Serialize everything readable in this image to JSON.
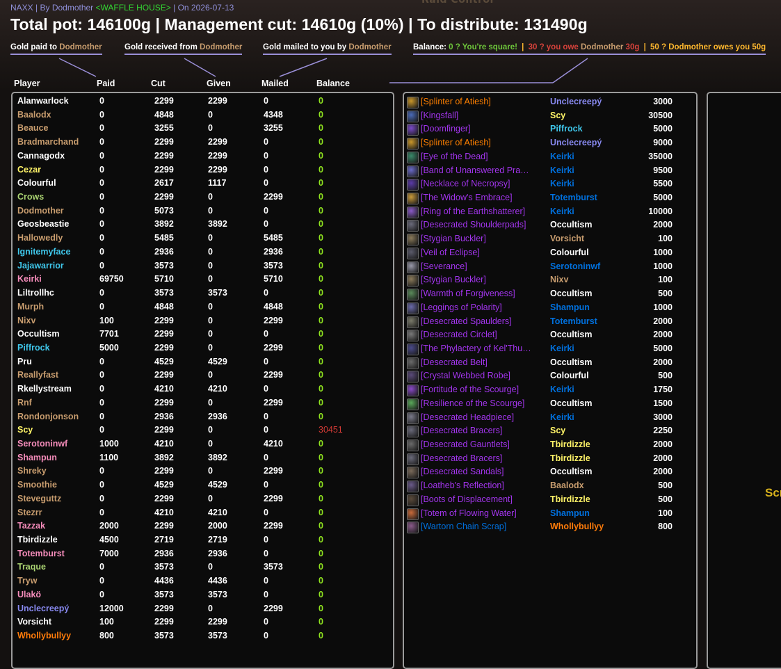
{
  "background": {
    "title": "Raid Control"
  },
  "header": {
    "raid": "NAXX",
    "by_label": "| By Dodmother",
    "guild": "<WAFFLE HOUSE>",
    "date": "| On 2026-07-13",
    "summary": "Total pot: 146100g | Management cut: 14610g (10%) | To distribute: 131490g"
  },
  "legend": {
    "paid_prefix": "Gold paid to",
    "received_prefix": "Gold received from",
    "mailed_prefix": "Gold mailed to you by",
    "name": "Dodmother",
    "balance_label": "Balance:",
    "square": "0 ? You're square!",
    "owe_prefix": "30 ? you owe",
    "owe_amount": "30g",
    "owes_prefix": "50 ? Dodmother owes you 50g",
    "sep": "|"
  },
  "columns": {
    "player": "Player",
    "paid": "Paid",
    "cut": "Cut",
    "given": "Given",
    "mailed": "Mailed",
    "balance": "Balance"
  },
  "class_colors": {
    "warlock": "#8788ee",
    "warrior": "#c79c6e",
    "priest": "#ffffff",
    "rogue": "#fff468",
    "hunter": "#aad372",
    "mage": "#3fc7eb",
    "paladin": "#f48cba",
    "shaman": "#0070dd",
    "druid": "#ff7c0a"
  },
  "players": [
    {
      "name": "Alanwarlock",
      "cls": "priest",
      "paid": "0",
      "cut": "2299",
      "given": "2299",
      "mailed": "0",
      "balance": "0"
    },
    {
      "name": "Baalodx",
      "cls": "warrior",
      "paid": "0",
      "cut": "4848",
      "given": "0",
      "mailed": "4348",
      "balance": "0"
    },
    {
      "name": "Beauce",
      "cls": "warrior",
      "paid": "0",
      "cut": "3255",
      "given": "0",
      "mailed": "3255",
      "balance": "0"
    },
    {
      "name": "Bradmarchand",
      "cls": "warrior",
      "paid": "0",
      "cut": "2299",
      "given": "2299",
      "mailed": "0",
      "balance": "0"
    },
    {
      "name": "Cannagodx",
      "cls": "priest",
      "paid": "0",
      "cut": "2299",
      "given": "2299",
      "mailed": "0",
      "balance": "0"
    },
    {
      "name": "Cezar",
      "cls": "rogue",
      "paid": "0",
      "cut": "2299",
      "given": "2299",
      "mailed": "0",
      "balance": "0"
    },
    {
      "name": "Colourful",
      "cls": "priest",
      "paid": "0",
      "cut": "2617",
      "given": "1117",
      "mailed": "0",
      "balance": "0"
    },
    {
      "name": "Crows",
      "cls": "hunter",
      "paid": "0",
      "cut": "2299",
      "given": "0",
      "mailed": "2299",
      "balance": "0"
    },
    {
      "name": "Dodmother",
      "cls": "warrior",
      "paid": "0",
      "cut": "5073",
      "given": "0",
      "mailed": "0",
      "balance": "0"
    },
    {
      "name": "Geosbeastie",
      "cls": "priest",
      "paid": "0",
      "cut": "3892",
      "given": "3892",
      "mailed": "0",
      "balance": "0"
    },
    {
      "name": "Hallowedly",
      "cls": "warrior",
      "paid": "0",
      "cut": "5485",
      "given": "0",
      "mailed": "5485",
      "balance": "0"
    },
    {
      "name": "Ignitemyface",
      "cls": "mage",
      "paid": "0",
      "cut": "2936",
      "given": "0",
      "mailed": "2936",
      "balance": "0"
    },
    {
      "name": "Jajawarrior",
      "cls": "mage",
      "paid": "0",
      "cut": "3573",
      "given": "0",
      "mailed": "3573",
      "balance": "0"
    },
    {
      "name": "Keirki",
      "cls": "paladin",
      "paid": "69750",
      "cut": "5710",
      "given": "0",
      "mailed": "5710",
      "balance": "0"
    },
    {
      "name": "Liltrollhc",
      "cls": "priest",
      "paid": "0",
      "cut": "3573",
      "given": "3573",
      "mailed": "0",
      "balance": "0"
    },
    {
      "name": "Murph",
      "cls": "warrior",
      "paid": "0",
      "cut": "4848",
      "given": "0",
      "mailed": "4848",
      "balance": "0"
    },
    {
      "name": "Nixv",
      "cls": "warrior",
      "paid": "100",
      "cut": "2299",
      "given": "0",
      "mailed": "2299",
      "balance": "0"
    },
    {
      "name": "Occultism",
      "cls": "priest",
      "paid": "7701",
      "cut": "2299",
      "given": "0",
      "mailed": "0",
      "balance": "0"
    },
    {
      "name": "Piffrock",
      "cls": "mage",
      "paid": "5000",
      "cut": "2299",
      "given": "0",
      "mailed": "2299",
      "balance": "0"
    },
    {
      "name": "Pru",
      "cls": "priest",
      "paid": "0",
      "cut": "4529",
      "given": "4529",
      "mailed": "0",
      "balance": "0"
    },
    {
      "name": "Reallyfast",
      "cls": "warrior",
      "paid": "0",
      "cut": "2299",
      "given": "0",
      "mailed": "2299",
      "balance": "0"
    },
    {
      "name": "Rkellystream",
      "cls": "priest",
      "paid": "0",
      "cut": "4210",
      "given": "4210",
      "mailed": "0",
      "balance": "0"
    },
    {
      "name": "Rnf",
      "cls": "warrior",
      "paid": "0",
      "cut": "2299",
      "given": "0",
      "mailed": "2299",
      "balance": "0"
    },
    {
      "name": "Rondonjonson",
      "cls": "warrior",
      "paid": "0",
      "cut": "2936",
      "given": "2936",
      "mailed": "0",
      "balance": "0"
    },
    {
      "name": "Scy",
      "cls": "rogue",
      "paid": "0",
      "cut": "2299",
      "given": "0",
      "mailed": "0",
      "balance": "30451",
      "neg": true
    },
    {
      "name": "Serotoninwf",
      "cls": "paladin",
      "paid": "1000",
      "cut": "4210",
      "given": "0",
      "mailed": "4210",
      "balance": "0"
    },
    {
      "name": "Shampun",
      "cls": "paladin",
      "paid": "1100",
      "cut": "3892",
      "given": "3892",
      "mailed": "0",
      "balance": "0"
    },
    {
      "name": "Shreky",
      "cls": "warrior",
      "paid": "0",
      "cut": "2299",
      "given": "0",
      "mailed": "2299",
      "balance": "0"
    },
    {
      "name": "Smoothie",
      "cls": "warrior",
      "paid": "0",
      "cut": "4529",
      "given": "4529",
      "mailed": "0",
      "balance": "0"
    },
    {
      "name": "Steveguttz",
      "cls": "warrior",
      "paid": "0",
      "cut": "2299",
      "given": "0",
      "mailed": "2299",
      "balance": "0"
    },
    {
      "name": "Stezrr",
      "cls": "warrior",
      "paid": "0",
      "cut": "4210",
      "given": "4210",
      "mailed": "0",
      "balance": "0"
    },
    {
      "name": "Tazzak",
      "cls": "paladin",
      "paid": "2000",
      "cut": "2299",
      "given": "2000",
      "mailed": "2299",
      "balance": "0"
    },
    {
      "name": "Tbirdizzle",
      "cls": "priest",
      "paid": "4500",
      "cut": "2719",
      "given": "2719",
      "mailed": "0",
      "balance": "0"
    },
    {
      "name": "Totemburst",
      "cls": "paladin",
      "paid": "7000",
      "cut": "2936",
      "given": "2936",
      "mailed": "0",
      "balance": "0"
    },
    {
      "name": "Traque",
      "cls": "hunter",
      "paid": "0",
      "cut": "3573",
      "given": "0",
      "mailed": "3573",
      "balance": "0"
    },
    {
      "name": "Tryw",
      "cls": "warrior",
      "paid": "0",
      "cut": "4436",
      "given": "4436",
      "mailed": "0",
      "balance": "0"
    },
    {
      "name": "Ulakö",
      "cls": "paladin",
      "paid": "0",
      "cut": "3573",
      "given": "3573",
      "mailed": "0",
      "balance": "0"
    },
    {
      "name": "Unclecreepý",
      "cls": "warlock",
      "paid": "12000",
      "cut": "2299",
      "given": "0",
      "mailed": "2299",
      "balance": "0"
    },
    {
      "name": "Vorsicht",
      "cls": "priest",
      "paid": "100",
      "cut": "2299",
      "given": "2299",
      "mailed": "0",
      "balance": "0"
    },
    {
      "name": "Whollybullyy",
      "cls": "druid",
      "paid": "800",
      "cut": "3573",
      "given": "3573",
      "mailed": "0",
      "balance": "0"
    }
  ],
  "items": [
    {
      "item": "[Splinter of Atiesh]",
      "q": "leg",
      "icon": "splinter-icon",
      "ic": "#c8962a",
      "winner": "Unclecreepý",
      "wc": "warlock",
      "price": "3000"
    },
    {
      "item": "[Kingsfall]",
      "q": "epic",
      "icon": "dagger-icon",
      "ic": "#4a6ab8",
      "winner": "Scy",
      "wc": "rogue",
      "price": "30500"
    },
    {
      "item": "[Doomfinger]",
      "q": "epic",
      "icon": "wand-icon",
      "ic": "#7a4ac8",
      "winner": "Piffrock",
      "wc": "mage",
      "price": "5000"
    },
    {
      "item": "[Splinter of Atiesh]",
      "q": "leg",
      "icon": "splinter-icon",
      "ic": "#c8962a",
      "winner": "Unclecreepý",
      "wc": "warlock",
      "price": "9000"
    },
    {
      "item": "[Eye of the Dead]",
      "q": "epic",
      "icon": "trinket-icon",
      "ic": "#3a8a6a",
      "winner": "Keirki",
      "wc": "shaman",
      "price": "35000"
    },
    {
      "item": "[Band of Unanswered Pra…",
      "q": "epic",
      "icon": "ring-icon",
      "ic": "#6a6ac8",
      "winner": "Keirki",
      "wc": "shaman",
      "price": "9500"
    },
    {
      "item": "[Necklace of Necropsy]",
      "q": "epic",
      "icon": "necklace-icon",
      "ic": "#5a3aa8",
      "winner": "Keirki",
      "wc": "shaman",
      "price": "5500"
    },
    {
      "item": "[The Widow's Embrace]",
      "q": "epic",
      "icon": "mace-icon",
      "ic": "#c89a3a",
      "winner": "Totemburst",
      "wc": "shaman",
      "price": "5000"
    },
    {
      "item": "[Ring of the Earthshatterer]",
      "q": "epic",
      "icon": "ring-icon",
      "ic": "#8a5ac8",
      "winner": "Keirki",
      "wc": "shaman",
      "price": "10000"
    },
    {
      "item": "[Desecrated Shoulderpads]",
      "q": "epic",
      "icon": "shoulder-icon",
      "ic": "#6a6a7a",
      "winner": "Occultism",
      "wc": "priest",
      "price": "2000"
    },
    {
      "item": "[Stygian Buckler]",
      "q": "epic",
      "icon": "shield-icon",
      "ic": "#8a7a5a",
      "winner": "Vorsicht",
      "wc": "warrior",
      "price": "100"
    },
    {
      "item": "[Veil of Eclipse]",
      "q": "epic",
      "icon": "cloak-icon",
      "ic": "#5a5a6a",
      "winner": "Colourful",
      "wc": "priest",
      "price": "1000"
    },
    {
      "item": "[Severance]",
      "q": "epic",
      "icon": "axe-icon",
      "ic": "#9a9aaa",
      "winner": "Serotoninwf",
      "wc": "shaman",
      "price": "1000"
    },
    {
      "item": "[Stygian Buckler]",
      "q": "epic",
      "icon": "shield-icon",
      "ic": "#8a7a5a",
      "winner": "Nixv",
      "wc": "warrior",
      "price": "100"
    },
    {
      "item": "[Warmth of Forgiveness]",
      "q": "epic",
      "icon": "trinket-icon",
      "ic": "#5a8a5a",
      "winner": "Occultism",
      "wc": "priest",
      "price": "500"
    },
    {
      "item": "[Leggings of Polarity]",
      "q": "epic",
      "icon": "legs-icon",
      "ic": "#6a6aaa",
      "winner": "Shampun",
      "wc": "shaman",
      "price": "1000"
    },
    {
      "item": "[Desecrated Spaulders]",
      "q": "epic",
      "icon": "shoulder-icon",
      "ic": "#7a7a6a",
      "winner": "Totemburst",
      "wc": "shaman",
      "price": "2000"
    },
    {
      "item": "[Desecrated Circlet]",
      "q": "epic",
      "icon": "helm-icon",
      "ic": "#7a7a7a",
      "winner": "Occultism",
      "wc": "priest",
      "price": "2000"
    },
    {
      "item": "[The Phylactery of Kel'Thu…",
      "q": "epic",
      "icon": "phylactery-icon",
      "ic": "#4a4a8a",
      "winner": "Keirki",
      "wc": "shaman",
      "price": "5000"
    },
    {
      "item": "[Desecrated Belt]",
      "q": "epic",
      "icon": "belt-icon",
      "ic": "#6a6a6a",
      "winner": "Occultism",
      "wc": "priest",
      "price": "2000"
    },
    {
      "item": "[Crystal Webbed Robe]",
      "q": "epic",
      "icon": "robe-icon",
      "ic": "#5a4a7a",
      "winner": "Colourful",
      "wc": "priest",
      "price": "500"
    },
    {
      "item": "[Fortitude of the Scourge]",
      "q": "epic",
      "icon": "scroll-icon",
      "ic": "#8a4ac8",
      "winner": "Keirki",
      "wc": "shaman",
      "price": "1750"
    },
    {
      "item": "[Resilience of the Scourge]",
      "q": "epic",
      "icon": "scroll-icon",
      "ic": "#5aa85a",
      "winner": "Occultism",
      "wc": "priest",
      "price": "1500"
    },
    {
      "item": "[Desecrated Headpiece]",
      "q": "epic",
      "icon": "helm-icon",
      "ic": "#7a7a8a",
      "winner": "Keirki",
      "wc": "shaman",
      "price": "3000"
    },
    {
      "item": "[Desecrated Bracers]",
      "q": "epic",
      "icon": "bracer-icon",
      "ic": "#6a6a7a",
      "winner": "Scy",
      "wc": "rogue",
      "price": "2250"
    },
    {
      "item": "[Desecrated Gauntlets]",
      "q": "epic",
      "icon": "gloves-icon",
      "ic": "#6a6a6a",
      "winner": "Tbirdizzle",
      "wc": "rogue",
      "price": "2000"
    },
    {
      "item": "[Desecrated Bracers]",
      "q": "epic",
      "icon": "bracer-icon",
      "ic": "#6a6a7a",
      "winner": "Tbirdizzle",
      "wc": "rogue",
      "price": "2000"
    },
    {
      "item": "[Desecrated Sandals]",
      "q": "epic",
      "icon": "boots-icon",
      "ic": "#7a6a5a",
      "winner": "Occultism",
      "wc": "priest",
      "price": "2000"
    },
    {
      "item": "[Loatheb's Reflection]",
      "q": "epic",
      "icon": "trinket-icon",
      "ic": "#6a5a8a",
      "winner": "Baalodx",
      "wc": "warrior",
      "price": "500"
    },
    {
      "item": "[Boots of Displacement]",
      "q": "epic",
      "icon": "boots-icon",
      "ic": "#5a4a3a",
      "winner": "Tbirdizzle",
      "wc": "rogue",
      "price": "500"
    },
    {
      "item": "[Totem of Flowing Water]",
      "q": "epic",
      "icon": "totem-icon",
      "ic": "#c86a3a",
      "winner": "Shampun",
      "wc": "shaman",
      "price": "100"
    },
    {
      "item": "[Wartorn Chain Scrap]",
      "q": "rare",
      "icon": "chain-scrap-icon",
      "ic": "#8a5a8a",
      "winner": "Whollybullyy",
      "wc": "druid",
      "price": "800"
    }
  ],
  "right_panel": {
    "text": "Scr"
  }
}
